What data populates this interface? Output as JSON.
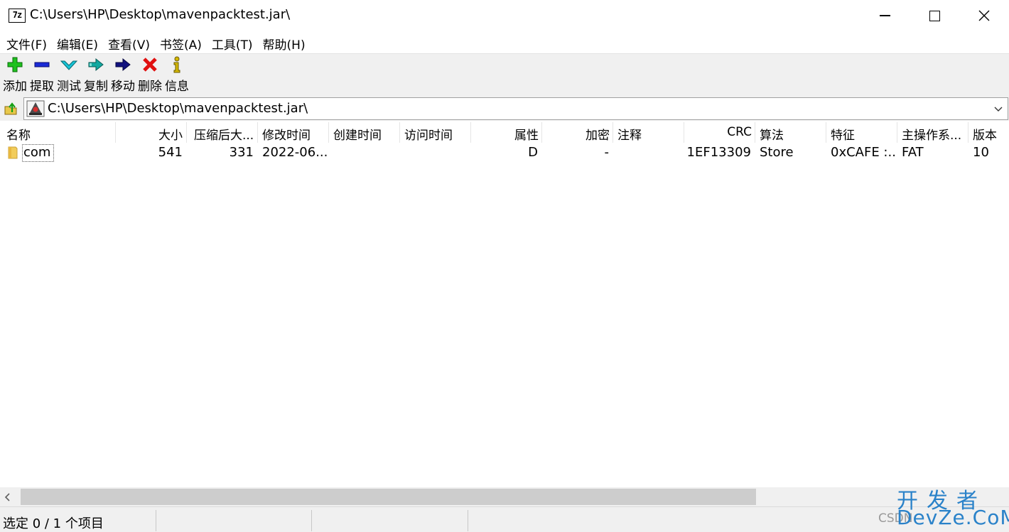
{
  "window": {
    "app_icon_text": "7z",
    "title": "C:\\Users\\HP\\Desktop\\mavenpacktest.jar\\"
  },
  "menu": [
    {
      "label": "文件(F)"
    },
    {
      "label": "编辑(E)"
    },
    {
      "label": "查看(V)"
    },
    {
      "label": "书签(A)"
    },
    {
      "label": "工具(T)"
    },
    {
      "label": "帮助(H)"
    }
  ],
  "toolbar": [
    {
      "label": "添加",
      "icon": "add-icon",
      "color": "#1fc11f"
    },
    {
      "label": "提取",
      "icon": "extract-icon",
      "color": "#1a2bd6"
    },
    {
      "label": "测试",
      "icon": "test-icon",
      "color": "#17c3d6"
    },
    {
      "label": "复制",
      "icon": "copy-icon",
      "color": "#13a8a0"
    },
    {
      "label": "移动",
      "icon": "move-icon",
      "color": "#12127f"
    },
    {
      "label": "删除",
      "icon": "delete-icon",
      "color": "#e01010"
    },
    {
      "label": "信息",
      "icon": "info-icon",
      "color": "#d4b800"
    }
  ],
  "address": {
    "path": "C:\\Users\\HP\\Desktop\\mavenpacktest.jar\\"
  },
  "columns": [
    {
      "label": "名称",
      "align": "left"
    },
    {
      "label": "大小",
      "align": "right"
    },
    {
      "label": "压缩后大...",
      "align": "left"
    },
    {
      "label": "修改时间",
      "align": "left"
    },
    {
      "label": "创建时间",
      "align": "left"
    },
    {
      "label": "访问时间",
      "align": "left"
    },
    {
      "label": "属性",
      "align": "right"
    },
    {
      "label": "加密",
      "align": "right"
    },
    {
      "label": "注释",
      "align": "left"
    },
    {
      "label": "CRC",
      "align": "right"
    },
    {
      "label": "算法",
      "align": "left"
    },
    {
      "label": "特征",
      "align": "left"
    },
    {
      "label": "主操作系...",
      "align": "left"
    },
    {
      "label": "版本",
      "align": "left"
    }
  ],
  "rows": [
    {
      "name": "com",
      "size": "541",
      "packed": "331",
      "modified": "2022-06...",
      "created": "",
      "accessed": "",
      "attributes": "D",
      "encrypted": "-",
      "comment": "",
      "crc": "1EF13309",
      "method": "Store",
      "characteristics": "0xCAFE :...",
      "host_os": "FAT",
      "version": "10"
    }
  ],
  "status": {
    "selection": "选定 0 / 1 个项目"
  },
  "watermark": {
    "top": "开发者",
    "left": "CSDN",
    "bottom": "DevZe.CoM",
    "color": "#2a82c9"
  }
}
